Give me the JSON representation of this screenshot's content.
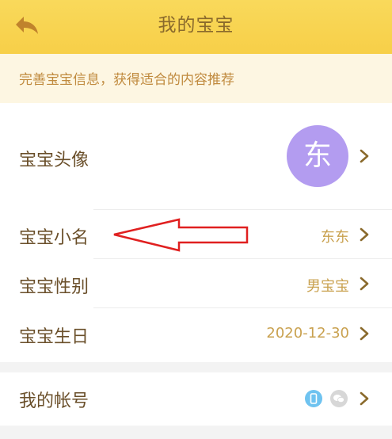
{
  "header": {
    "title": "我的宝宝"
  },
  "notice": {
    "text": "完善宝宝信息，获得适合的内容推荐"
  },
  "rows": {
    "avatar": {
      "label": "宝宝头像",
      "avatar_char": "东",
      "avatar_color": "#b39cf0"
    },
    "nickname": {
      "label": "宝宝小名",
      "value": "东东"
    },
    "gender": {
      "label": "宝宝性别",
      "value": "男宝宝"
    },
    "birthday": {
      "label": "宝宝生日",
      "value": "2020-12-30"
    }
  },
  "account": {
    "label": "我的帐号",
    "icons": [
      "phone-icon",
      "wechat-icon"
    ]
  },
  "colors": {
    "header": "#f8d552",
    "title": "#8a6a2c",
    "accent_value": "#c9a14f",
    "arrow_annotation": "#e02020"
  }
}
